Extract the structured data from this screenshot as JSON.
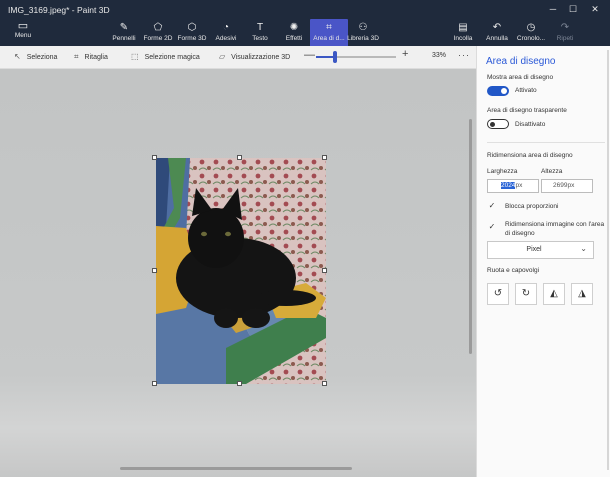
{
  "window": {
    "title": "IMG_3169.jpeg* - Paint 3D",
    "controls": {
      "minimize": "─",
      "maximize": "☐",
      "close": "✕"
    }
  },
  "ribbon": {
    "menu": {
      "icon": "▭",
      "label": "Menu"
    },
    "tools": [
      {
        "name": "pennelli",
        "icon": "✎",
        "label": "Pennelli",
        "active": false
      },
      {
        "name": "forme-2d",
        "icon": "⬠",
        "label": "Forme 2D",
        "active": false
      },
      {
        "name": "forme-3d",
        "icon": "⬡",
        "label": "Forme 3D",
        "active": false
      },
      {
        "name": "adesivi",
        "icon": "◔",
        "label": "Adesivi",
        "active": false
      },
      {
        "name": "testo",
        "icon": "T",
        "label": "Testo",
        "active": false
      },
      {
        "name": "effetti",
        "icon": "✺",
        "label": "Effetti",
        "active": false
      },
      {
        "name": "area-di-disegno",
        "icon": "⌗",
        "label": "Area di d...",
        "active": true
      },
      {
        "name": "libreria-3d",
        "icon": "⚇",
        "label": "Libreria 3D",
        "active": false
      }
    ],
    "right_tools": [
      {
        "name": "incolla",
        "icon": "▤",
        "label": "Incolla",
        "disabled": false
      },
      {
        "name": "annulla",
        "icon": "↶",
        "label": "Annulla",
        "disabled": false
      },
      {
        "name": "cronologia",
        "icon": "◷",
        "label": "Cronolo...",
        "disabled": false
      },
      {
        "name": "ripeti",
        "icon": "↷",
        "label": "Ripeti",
        "disabled": true
      }
    ]
  },
  "toolbar": {
    "seleziona": {
      "icon": "↖",
      "label": "Seleziona"
    },
    "ritaglia": {
      "icon": "⌗",
      "label": "Ritaglia"
    },
    "selezione_magica": {
      "icon": "⬚",
      "label": "Selezione magica"
    },
    "visualizzazione_3d": {
      "icon": "▱",
      "label": "Visualizzazione 3D"
    },
    "zoom_minus": "—",
    "zoom_plus": "+",
    "zoom_value": "33%",
    "zoom_level": 0.33,
    "more": "···"
  },
  "panel": {
    "title": "Area di disegno",
    "show_canvas": {
      "label": "Mostra area di disegno",
      "state_text": "Attivato",
      "on": true
    },
    "transparent_canvas": {
      "label": "Area di disegno trasparente",
      "state_text": "Disattivato",
      "on": false
    },
    "resize": {
      "label": "Ridimensiona area di disegno",
      "width_label": "Larghezza",
      "height_label": "Altezza",
      "width_value": "2024",
      "width_unit": "px",
      "height_value": "2699px"
    },
    "lock_proportions": {
      "label": "Blocca proporzioni",
      "checked": true
    },
    "resize_image": {
      "label": "Ridimensiona immagine con l'area di disegno",
      "checked": true
    },
    "unit_select": "Pixel",
    "rotate": {
      "label": "Ruota e capovolgi",
      "buttons": [
        {
          "name": "rotate-left",
          "icon": "↺"
        },
        {
          "name": "rotate-right",
          "icon": "↻"
        },
        {
          "name": "flip-horizontal",
          "icon": "◭"
        },
        {
          "name": "flip-vertical",
          "icon": "◮"
        }
      ]
    }
  },
  "colors": {
    "ribbon_bg": "#1f2a3c",
    "accent": "#2b59d7",
    "active_tool": "#4a55c7",
    "toggle_on": "#2157c7"
  }
}
